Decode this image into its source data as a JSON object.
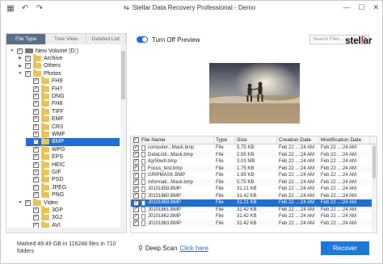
{
  "window": {
    "title": "Stellar Data Recovery Professional - Demo",
    "back_arrow": "⇆"
  },
  "logo": {
    "text_a": "stel",
    "text_b": "l",
    "text_c": "ar"
  },
  "tabs": [
    {
      "label": "File Type",
      "active": true
    },
    {
      "label": "Tree View",
      "active": false
    },
    {
      "label": "Deleted List",
      "active": false
    }
  ],
  "tree": [
    {
      "label": "New Volume (D:)",
      "level": 0,
      "expanded": true,
      "icon": "drive",
      "checked": true
    },
    {
      "label": "Archive",
      "level": 1,
      "expanded": false,
      "icon": "folder",
      "checked": true
    },
    {
      "label": "Others",
      "level": 1,
      "expanded": false,
      "icon": "folder",
      "checked": true
    },
    {
      "label": "Photos",
      "level": 1,
      "expanded": true,
      "icon": "folder",
      "checked": true
    },
    {
      "label": "FH9",
      "level": 2,
      "icon": "folder",
      "checked": true
    },
    {
      "label": "FH7",
      "level": 2,
      "icon": "folder",
      "checked": true
    },
    {
      "label": "DNG",
      "level": 2,
      "icon": "folder",
      "checked": true
    },
    {
      "label": "FH8",
      "level": 2,
      "icon": "folder",
      "checked": true
    },
    {
      "label": "TIFF",
      "level": 2,
      "icon": "folder",
      "checked": true
    },
    {
      "label": "EMF",
      "level": 2,
      "icon": "folder",
      "checked": true
    },
    {
      "label": "CR3",
      "level": 2,
      "icon": "folder",
      "checked": true
    },
    {
      "label": "WMF",
      "level": 2,
      "icon": "folder",
      "checked": true
    },
    {
      "label": "BMP",
      "level": 2,
      "icon": "folder",
      "checked": true,
      "selected": true
    },
    {
      "label": "WPG",
      "level": 2,
      "icon": "folder",
      "checked": true
    },
    {
      "label": "EPS",
      "level": 2,
      "icon": "folder",
      "checked": true
    },
    {
      "label": "HEIC",
      "level": 2,
      "icon": "folder",
      "checked": true
    },
    {
      "label": "GIF",
      "level": 2,
      "icon": "folder",
      "checked": true
    },
    {
      "label": "PSD",
      "level": 2,
      "icon": "folder",
      "checked": true
    },
    {
      "label": "JPEG",
      "level": 2,
      "icon": "folder",
      "checked": true
    },
    {
      "label": "PNG",
      "level": 2,
      "icon": "folder",
      "checked": true
    },
    {
      "label": "Video",
      "level": 1,
      "expanded": true,
      "icon": "folder",
      "checked": true
    },
    {
      "label": "3GP",
      "level": 2,
      "icon": "folder",
      "checked": true
    },
    {
      "label": "3G2",
      "level": 2,
      "icon": "folder",
      "checked": true
    },
    {
      "label": "AVI",
      "level": 2,
      "icon": "folder",
      "checked": true
    }
  ],
  "preview": {
    "toggle_label": "Turn Off Preview",
    "toggle_on": true
  },
  "search": {
    "placeholder": "Search Files..."
  },
  "grid": {
    "headers": [
      "File Name",
      "Type",
      "Size",
      "Creation Date",
      "Modification Date"
    ],
    "rows": [
      {
        "name": "computer...Mask.bmp",
        "type": "File",
        "size": "5.75 KB",
        "created": "Feb 22 ...:24 AM",
        "modified": "Feb 22 ...:24 AM"
      },
      {
        "name": "DataListi...Mask.bmp",
        "type": "File",
        "size": "2.55 KB",
        "created": "Feb 22 ...:24 AM",
        "modified": "Feb 22 ...:24 AM"
      },
      {
        "name": "dgr5tiw8.bmp",
        "type": "File",
        "size": "3.03 MB",
        "created": "Feb 22 ...:24 AM",
        "modified": "Feb 22 ...:24 AM"
      },
      {
        "name": "Focus_test.bmp",
        "type": "File",
        "size": "1.75 KB",
        "created": "Feb 22 ...:24 AM",
        "modified": "Feb 22 ...:24 AM"
      },
      {
        "name": "GRIPMASK.BMP",
        "type": "File",
        "size": "1.99 KB",
        "created": "Feb 22 ...:24 AM",
        "modified": "Feb 22 ...:24 AM"
      },
      {
        "name": "Informati...Mask.bmp",
        "type": "File",
        "size": "5.75 KB",
        "created": "Feb 22 ...:24 AM",
        "modified": "Feb 22 ...:24 AM"
      },
      {
        "name": "J0101858.BMP",
        "type": "File",
        "size": "31.21 KB",
        "created": "Feb 22 ...:24 AM",
        "modified": "Feb 22 ...:24 AM"
      },
      {
        "name": "J0101860.BMP",
        "type": "File",
        "size": "31.42 KB",
        "created": "Feb 22 ...:24 AM",
        "modified": "Feb 22 ...:24 AM"
      },
      {
        "name": "J0101859.BMP",
        "type": "File",
        "size": "31.21 KB",
        "created": "Feb 22 ...:24 AM",
        "modified": "Feb 22 ...:24 AM",
        "selected": true
      },
      {
        "name": "J0101861.BMP",
        "type": "File",
        "size": "31.42 KB",
        "created": "Feb 22 ...:24 AM",
        "modified": "Feb 22 ...:24 AM"
      },
      {
        "name": "J0101862.BMP",
        "type": "File",
        "size": "31.42 KB",
        "created": "Feb 22 ...:24 AM",
        "modified": "Feb 22 ...:24 AM"
      },
      {
        "name": "J0101863.BMP",
        "type": "File",
        "size": "31.42 KB",
        "created": "Feb 22 ...:24 AM",
        "modified": "Feb 22 ...:24 AM"
      }
    ]
  },
  "status": {
    "text": "Marked 49.49 GB in 116248 files in 710 folders"
  },
  "deep_scan": {
    "label": "Deep Scan",
    "link": "Click here"
  },
  "recover": {
    "label": "Recover"
  },
  "colors": {
    "accent": "#1f6ed0",
    "tab_active": "#5a6e86",
    "recover_button": "#1f78d8"
  }
}
